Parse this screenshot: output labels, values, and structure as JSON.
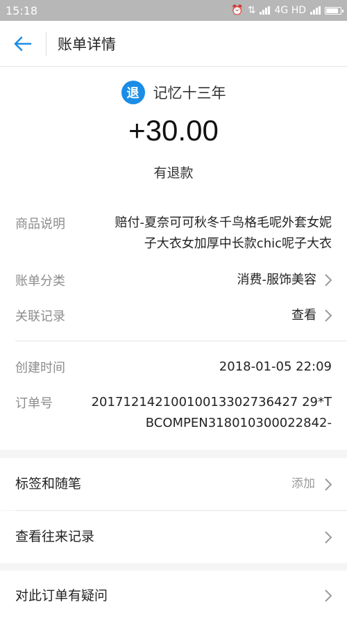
{
  "status_bar": {
    "time": "15:18",
    "network": "4G HD"
  },
  "nav": {
    "title": "账单详情"
  },
  "bill": {
    "badge": "退",
    "merchant": "记忆十三年",
    "amount": "+30.00",
    "status": "有退款"
  },
  "details": {
    "product": {
      "label": "商品说明",
      "line1": "赔付-夏奈可可秋冬千鸟格毛呢外套女妮",
      "line2": "子大衣女加厚中长款chic呢子大衣"
    },
    "category": {
      "label": "账单分类",
      "value": "消费-服饰美容"
    },
    "related": {
      "label": "关联记录",
      "value": "查看"
    },
    "created": {
      "label": "创建时间",
      "value": "2018-01-05 22:09"
    },
    "order": {
      "label": "订单号",
      "line1": "20171214210010013302736427 29*T",
      "line2": "BCOMPEN318010300022842-"
    }
  },
  "actions": {
    "tags": {
      "label": "标签和随笔",
      "hint": "添加"
    },
    "history": {
      "label": "查看往来记录"
    },
    "question": {
      "label": "对此订单有疑问"
    }
  }
}
